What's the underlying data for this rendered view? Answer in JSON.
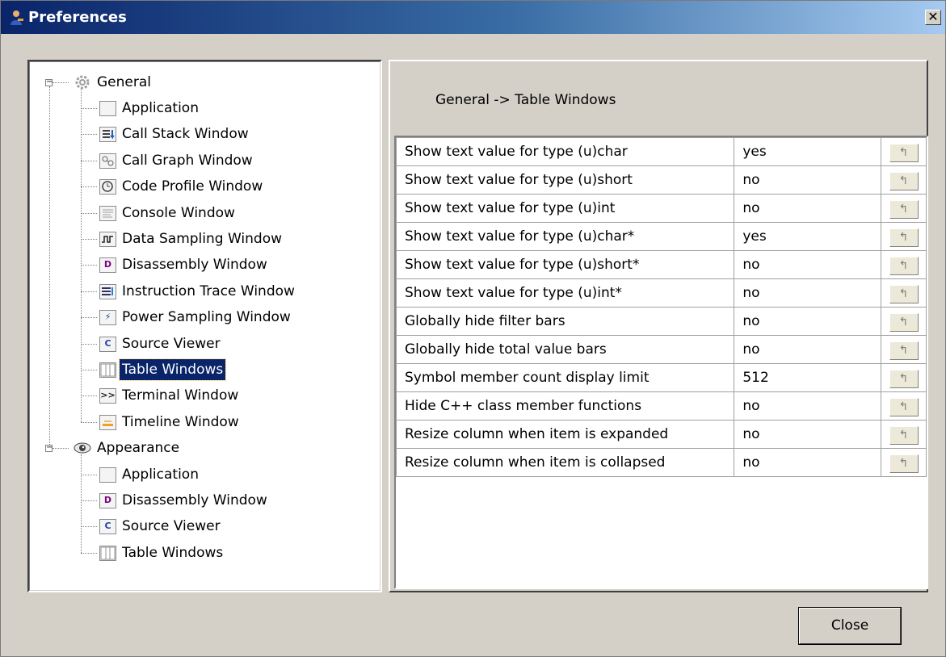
{
  "window": {
    "title": "Preferences",
    "close_glyph": "✕"
  },
  "tree": {
    "general": {
      "label": "General",
      "icon": "gear-icon",
      "children": [
        {
          "label": "Application",
          "icon": "window-icon"
        },
        {
          "label": "Call Stack Window",
          "icon": "call-stack-icon"
        },
        {
          "label": "Call Graph Window",
          "icon": "call-graph-icon"
        },
        {
          "label": "Code Profile Window",
          "icon": "clock-icon"
        },
        {
          "label": "Console Window",
          "icon": "console-icon"
        },
        {
          "label": "Data Sampling Window",
          "icon": "waveform-icon"
        },
        {
          "label": "Disassembly Window",
          "icon": "disassembly-icon",
          "glyph": "D"
        },
        {
          "label": "Instruction Trace Window",
          "icon": "instruction-trace-icon"
        },
        {
          "label": "Power Sampling Window",
          "icon": "lightning-icon",
          "glyph": "⚡"
        },
        {
          "label": "Source Viewer",
          "icon": "source-icon",
          "glyph": "C"
        },
        {
          "label": "Table Windows",
          "icon": "table-icon",
          "selected": true
        },
        {
          "label": "Terminal Window",
          "icon": "terminal-icon",
          "glyph": ">>"
        },
        {
          "label": "Timeline Window",
          "icon": "timeline-icon"
        }
      ]
    },
    "appearance": {
      "label": "Appearance",
      "icon": "eye-icon",
      "children": [
        {
          "label": "Application",
          "icon": "window-icon"
        },
        {
          "label": "Disassembly Window",
          "icon": "disassembly-icon",
          "glyph": "D"
        },
        {
          "label": "Source Viewer",
          "icon": "source-icon",
          "glyph": "C"
        },
        {
          "label": "Table Windows",
          "icon": "table-icon"
        }
      ]
    }
  },
  "breadcrumb": "General  ->  Table Windows",
  "settings": [
    {
      "name": "Show text value for type (u)char",
      "value": "yes"
    },
    {
      "name": "Show text value for type (u)short",
      "value": "no"
    },
    {
      "name": "Show text value for type (u)int",
      "value": "no"
    },
    {
      "name": "Show text value for type (u)char*",
      "value": "yes"
    },
    {
      "name": "Show text value for type (u)short*",
      "value": "no"
    },
    {
      "name": "Show text value for type (u)int*",
      "value": "no"
    },
    {
      "name": "Globally hide filter bars",
      "value": "no"
    },
    {
      "name": "Globally hide total value bars",
      "value": "no"
    },
    {
      "name": "Symbol member count display limit",
      "value": "512"
    },
    {
      "name": "Hide C++ class member functions",
      "value": "no"
    },
    {
      "name": "Resize column when item is expanded",
      "value": "no"
    },
    {
      "name": "Resize column when item is collapsed",
      "value": "no"
    }
  ],
  "revert_glyph": "↰",
  "buttons": {
    "close": "Close"
  },
  "colors": {
    "title_start": "#0a246a",
    "title_end": "#a6caf0",
    "selection": "#0a246a",
    "face": "#d4d0c8"
  }
}
